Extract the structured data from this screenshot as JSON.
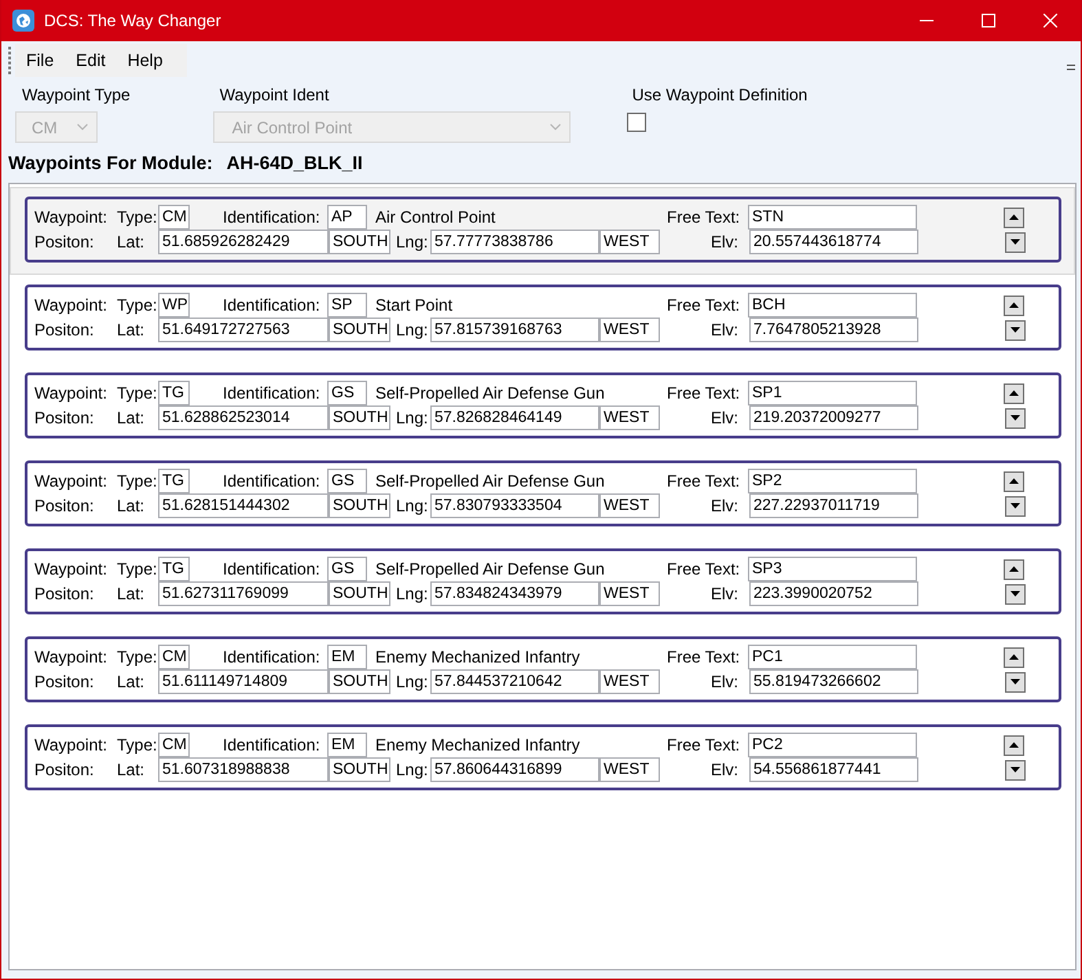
{
  "window": {
    "title": "DCS: The Way Changer"
  },
  "menu": [
    {
      "label": "File"
    },
    {
      "label": "Edit"
    },
    {
      "label": "Help"
    }
  ],
  "filters": {
    "waypoint_type": {
      "label": "Waypoint Type",
      "value": "CM",
      "disabled": true
    },
    "waypoint_ident": {
      "label": "Waypoint Ident",
      "value": "Air Control Point",
      "disabled": true
    },
    "use_waypoint_definition": {
      "label": "Use Waypoint Definition",
      "checked": false
    }
  },
  "module": {
    "label": "Waypoints For Module:",
    "name": "AH-64D_BLK_II"
  },
  "waypoints": [
    {
      "selected": true,
      "waypoint_label": "Waypoint:",
      "type_label": "Type:",
      "type": "CM",
      "identification_label": "Identification:",
      "identification": "AP",
      "description": "Air Control Point",
      "free_text_label": "Free Text:",
      "free_text": "STN",
      "position_label": "Positon:",
      "lat_label": "Lat:",
      "lat": "51.685926282429",
      "lat_hemisphere": "SOUTH",
      "lng_label": "Lng:",
      "lng": "57.77773838786",
      "lng_hemisphere": "WEST",
      "elv_label": "Elv:",
      "elv": "20.557443618774"
    },
    {
      "selected": false,
      "waypoint_label": "Waypoint:",
      "type_label": "Type:",
      "type": "WP",
      "identification_label": "Identification:",
      "identification": "SP",
      "description": "Start Point",
      "free_text_label": "Free Text:",
      "free_text": "BCH",
      "position_label": "Positon:",
      "lat_label": "Lat:",
      "lat": "51.649172727563",
      "lat_hemisphere": "SOUTH",
      "lng_label": "Lng:",
      "lng": "57.815739168763",
      "lng_hemisphere": "WEST",
      "elv_label": "Elv:",
      "elv": "7.7647805213928"
    },
    {
      "selected": false,
      "waypoint_label": "Waypoint:",
      "type_label": "Type:",
      "type": "TG",
      "identification_label": "Identification:",
      "identification": "GS",
      "description": "Self-Propelled Air Defense Gun",
      "free_text_label": "Free Text:",
      "free_text": "SP1",
      "position_label": "Positon:",
      "lat_label": "Lat:",
      "lat": "51.628862523014",
      "lat_hemisphere": "SOUTH",
      "lng_label": "Lng:",
      "lng": "57.826828464149",
      "lng_hemisphere": "WEST",
      "elv_label": "Elv:",
      "elv": "219.20372009277"
    },
    {
      "selected": false,
      "waypoint_label": "Waypoint:",
      "type_label": "Type:",
      "type": "TG",
      "identification_label": "Identification:",
      "identification": "GS",
      "description": "Self-Propelled Air Defense Gun",
      "free_text_label": "Free Text:",
      "free_text": "SP2",
      "position_label": "Positon:",
      "lat_label": "Lat:",
      "lat": "51.628151444302",
      "lat_hemisphere": "SOUTH",
      "lng_label": "Lng:",
      "lng": "57.830793333504",
      "lng_hemisphere": "WEST",
      "elv_label": "Elv:",
      "elv": "227.22937011719"
    },
    {
      "selected": false,
      "waypoint_label": "Waypoint:",
      "type_label": "Type:",
      "type": "TG",
      "identification_label": "Identification:",
      "identification": "GS",
      "description": "Self-Propelled Air Defense Gun",
      "free_text_label": "Free Text:",
      "free_text": "SP3",
      "position_label": "Positon:",
      "lat_label": "Lat:",
      "lat": "51.627311769099",
      "lat_hemisphere": "SOUTH",
      "lng_label": "Lng:",
      "lng": "57.834824343979",
      "lng_hemisphere": "WEST",
      "elv_label": "Elv:",
      "elv": "223.3990020752"
    },
    {
      "selected": false,
      "waypoint_label": "Waypoint:",
      "type_label": "Type:",
      "type": "CM",
      "identification_label": "Identification:",
      "identification": "EM",
      "description": "Enemy Mechanized Infantry",
      "free_text_label": "Free Text:",
      "free_text": "PC1",
      "position_label": "Positon:",
      "lat_label": "Lat:",
      "lat": "51.611149714809",
      "lat_hemisphere": "SOUTH",
      "lng_label": "Lng:",
      "lng": "57.844537210642",
      "lng_hemisphere": "WEST",
      "elv_label": "Elv:",
      "elv": "55.819473266602"
    },
    {
      "selected": false,
      "waypoint_label": "Waypoint:",
      "type_label": "Type:",
      "type": "CM",
      "identification_label": "Identification:",
      "identification": "EM",
      "description": "Enemy Mechanized Infantry",
      "free_text_label": "Free Text:",
      "free_text": "PC2",
      "position_label": "Positon:",
      "lat_label": "Lat:",
      "lat": "51.607318988838",
      "lat_hemisphere": "SOUTH",
      "lng_label": "Lng:",
      "lng": "57.860644316899",
      "lng_hemisphere": "WEST",
      "elv_label": "Elv:",
      "elv": "54.556861877441"
    }
  ]
}
